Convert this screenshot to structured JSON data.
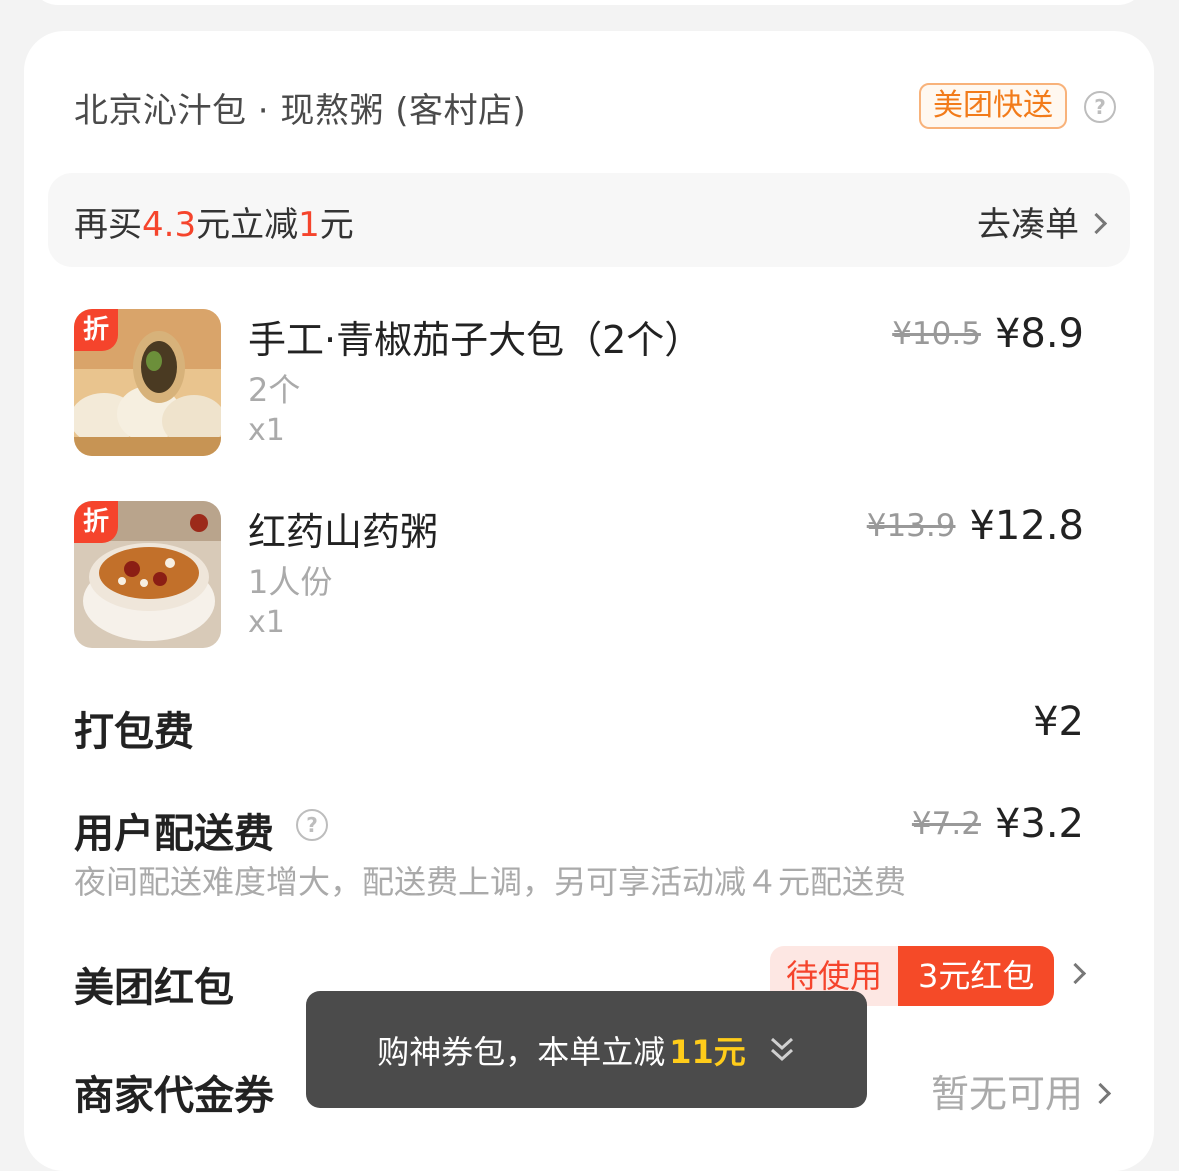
{
  "store": {
    "name": "北京沁汁包 · 现熬粥 (客村店)",
    "delivery_badge": "美团快送"
  },
  "promo": {
    "prefix": "再买",
    "amount": "4.3",
    "middle": "元立减",
    "discount": "1",
    "suffix": "元",
    "action": "去凑单"
  },
  "items": [
    {
      "discount_tag": "折",
      "name": "手工·青椒茄子大包（2个）",
      "spec": "2个",
      "qty": "x1",
      "original_price": "¥10.5",
      "price": "¥8.9"
    },
    {
      "discount_tag": "折",
      "name": "红药山药粥",
      "spec": "1人份",
      "qty": "x1",
      "original_price": "¥13.9",
      "price": "¥12.8"
    }
  ],
  "packaging": {
    "label": "打包费",
    "value": "¥2"
  },
  "delivery_fee": {
    "label": "用户配送费",
    "original": "¥7.2",
    "value": "¥3.2",
    "note": "夜间配送难度增大，配送费上调，另可享活动减４元配送费"
  },
  "red_packet": {
    "label": "美团红包",
    "status": "待使用",
    "amount": "3元红包"
  },
  "merchant_voucher": {
    "label": "商家代金券",
    "value": "暂无可用"
  },
  "toast": {
    "text": "购神券包，本单立减",
    "highlight": "11元"
  },
  "colors": {
    "accent_red": "#f5442c",
    "express_orange": "#f27b1a",
    "toast_highlight": "#ffcc1a"
  }
}
